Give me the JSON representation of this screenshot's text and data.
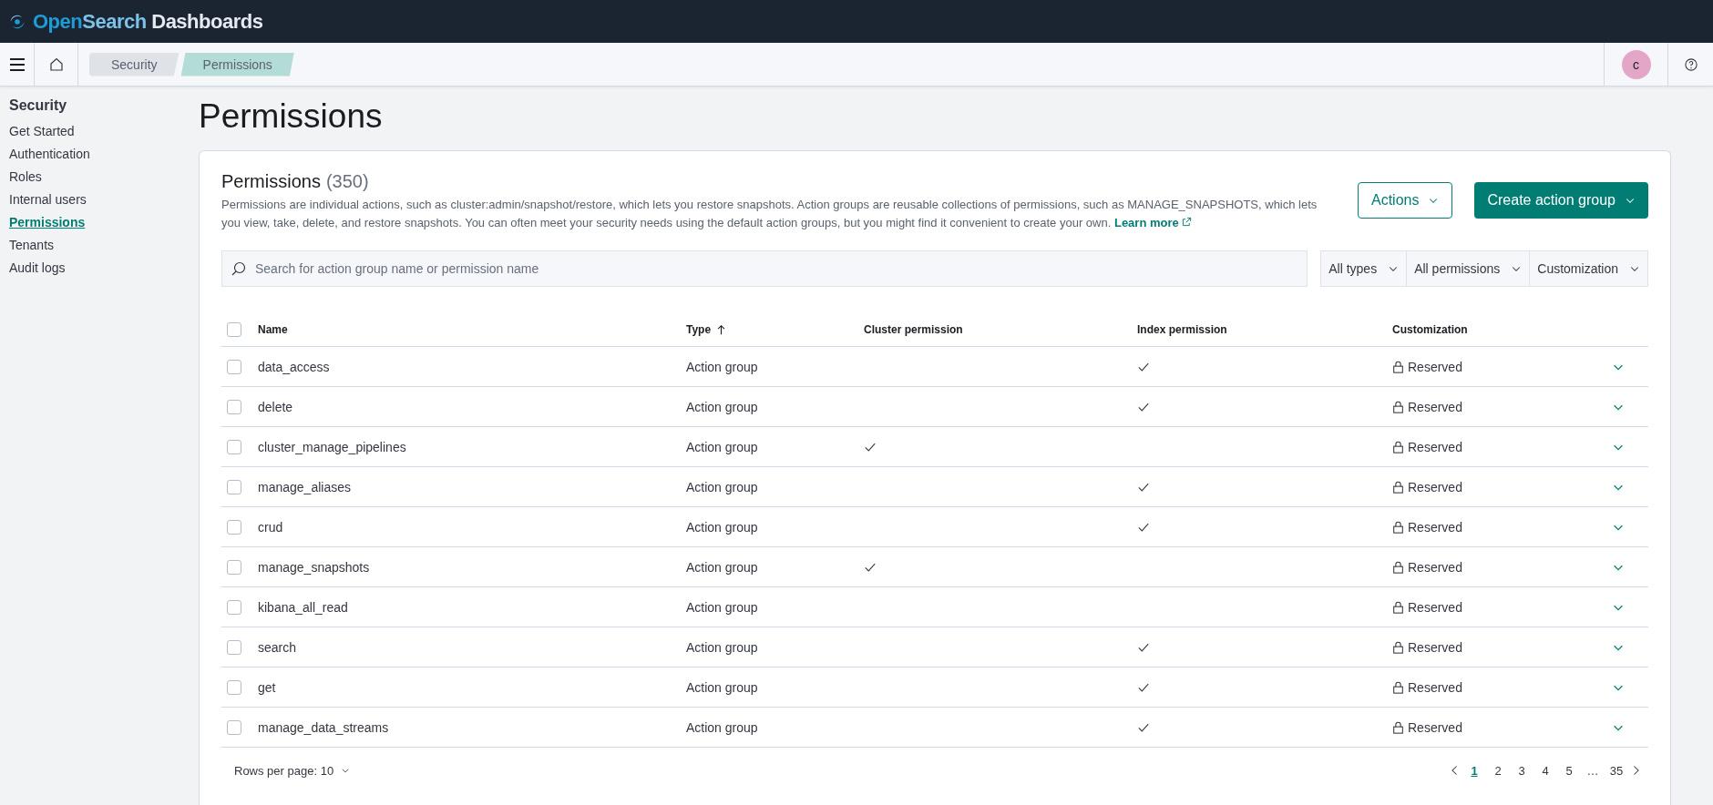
{
  "brand": {
    "name_part_1": "Open",
    "name_part_2": "Search",
    "name_part_3": " Dashboards"
  },
  "breadcrumbs": [
    {
      "label": "Security",
      "selected": false
    },
    {
      "label": "Permissions",
      "selected": true
    }
  ],
  "user": {
    "initial": "c"
  },
  "sidebar": {
    "title": "Security",
    "items": [
      {
        "label": "Get Started",
        "selected": false
      },
      {
        "label": "Authentication",
        "selected": false
      },
      {
        "label": "Roles",
        "selected": false
      },
      {
        "label": "Internal users",
        "selected": false
      },
      {
        "label": "Permissions",
        "selected": true
      },
      {
        "label": "Tenants",
        "selected": false
      },
      {
        "label": "Audit logs",
        "selected": false
      }
    ]
  },
  "page_title": "Permissions",
  "panel": {
    "title": "Permissions",
    "count": "(350)",
    "description": "Permissions are individual actions, such as cluster:admin/snapshot/restore, which lets you restore snapshots. Action groups are reusable collections of permissions, such as MANAGE_SNAPSHOTS, which lets you view, take, delete, and restore snapshots. You can often meet your security needs using the default action groups, but you might find it convenient to create your own.",
    "learn_more": "Learn more",
    "actions_button": "Actions",
    "create_button": "Create action group"
  },
  "search": {
    "placeholder": "Search for action group name or permission name"
  },
  "filters": [
    "All types",
    "All permissions",
    "Customization"
  ],
  "table": {
    "select_all_checked": false,
    "columns": [
      {
        "label": "Name",
        "sorted": false
      },
      {
        "label": "Type",
        "sorted": true
      },
      {
        "label": "Cluster permission",
        "sorted": false
      },
      {
        "label": "Index permission",
        "sorted": false
      },
      {
        "label": "Customization",
        "sorted": false
      }
    ],
    "rows": [
      {
        "name": "data_access",
        "type": "Action group",
        "cluster": false,
        "index": true,
        "customization": "Reserved",
        "checked": false
      },
      {
        "name": "delete",
        "type": "Action group",
        "cluster": false,
        "index": true,
        "customization": "Reserved",
        "checked": false
      },
      {
        "name": "cluster_manage_pipelines",
        "type": "Action group",
        "cluster": true,
        "index": false,
        "customization": "Reserved",
        "checked": false
      },
      {
        "name": "manage_aliases",
        "type": "Action group",
        "cluster": false,
        "index": true,
        "customization": "Reserved",
        "checked": false
      },
      {
        "name": "crud",
        "type": "Action group",
        "cluster": false,
        "index": true,
        "customization": "Reserved",
        "checked": false
      },
      {
        "name": "manage_snapshots",
        "type": "Action group",
        "cluster": true,
        "index": false,
        "customization": "Reserved",
        "checked": false
      },
      {
        "name": "kibana_all_read",
        "type": "Action group",
        "cluster": false,
        "index": false,
        "customization": "Reserved",
        "checked": false
      },
      {
        "name": "search",
        "type": "Action group",
        "cluster": false,
        "index": true,
        "customization": "Reserved",
        "checked": false
      },
      {
        "name": "get",
        "type": "Action group",
        "cluster": false,
        "index": true,
        "customization": "Reserved",
        "checked": false
      },
      {
        "name": "manage_data_streams",
        "type": "Action group",
        "cluster": false,
        "index": true,
        "customization": "Reserved",
        "checked": false
      }
    ]
  },
  "pagination": {
    "rows_per_page": "Rows per page: 10",
    "pages": [
      {
        "label": "1",
        "selected": true
      },
      {
        "label": "2",
        "selected": false
      },
      {
        "label": "3",
        "selected": false
      },
      {
        "label": "4",
        "selected": false
      },
      {
        "label": "5",
        "selected": false
      },
      {
        "label": "…",
        "selected": false
      },
      {
        "label": "35",
        "selected": false
      }
    ]
  }
}
